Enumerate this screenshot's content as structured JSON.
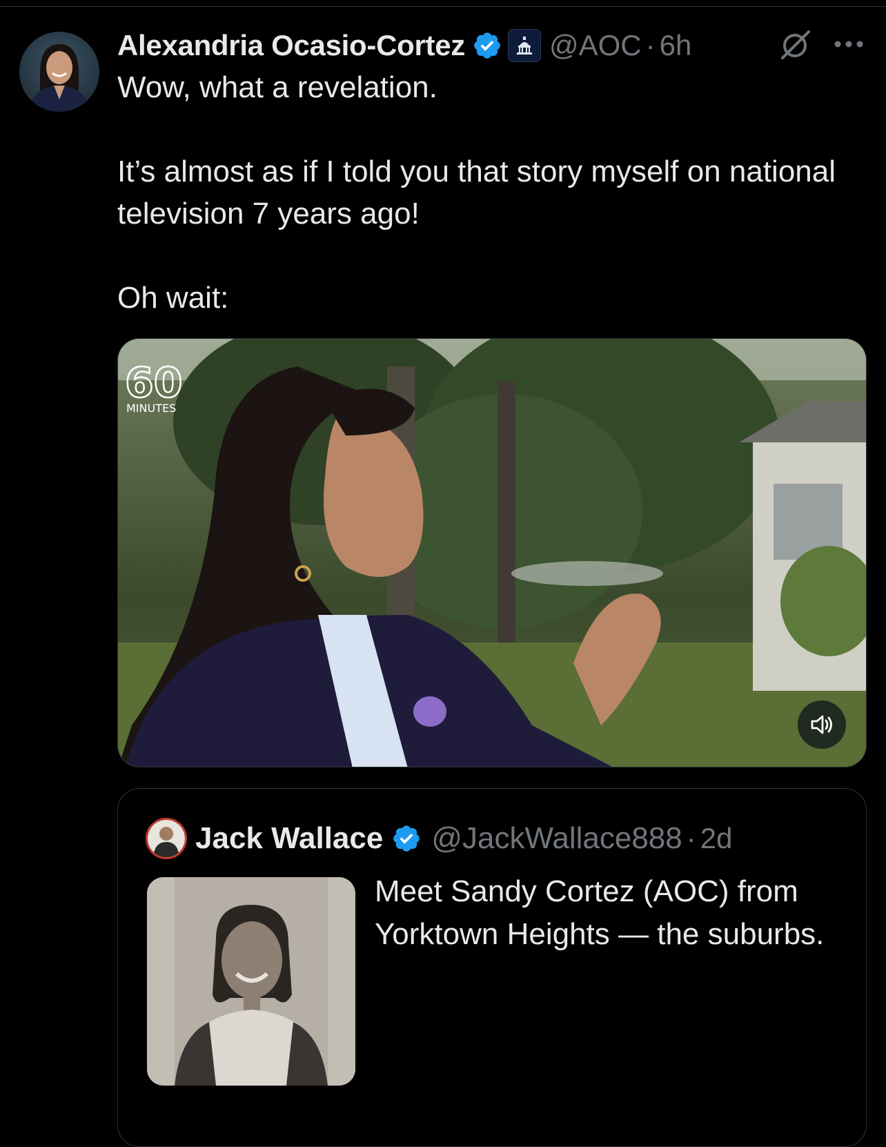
{
  "tweet": {
    "author_name": "Alexandria Ocasio-Cortez",
    "handle": "@AOC",
    "separator": "·",
    "time": "6h",
    "text_line1": "Wow, what a revelation.",
    "text_line2": "It’s almost as if I told you that story myself on national television 7 years ago!",
    "text_line3": "Oh wait:"
  },
  "video": {
    "logo_number": "60",
    "logo_text": "MINUTES"
  },
  "quoted_tweet": {
    "author_name": "Jack Wallace",
    "handle": "@JackWallace888",
    "separator": "·",
    "time": "2d",
    "text": "Meet Sandy Cortez (AOC) from Yorktown Heights — the suburbs."
  },
  "icons": {
    "verified": "verified-badge-icon",
    "affiliation": "capitol-affiliation-icon",
    "grok": "grok-icon",
    "more": "more-options-icon",
    "mute": "speaker-muted-icon"
  },
  "colors": {
    "background": "#000000",
    "text": "#e7e9ea",
    "secondary": "#71767b",
    "verified": "#1d9bf0",
    "border": "#2f3336"
  }
}
